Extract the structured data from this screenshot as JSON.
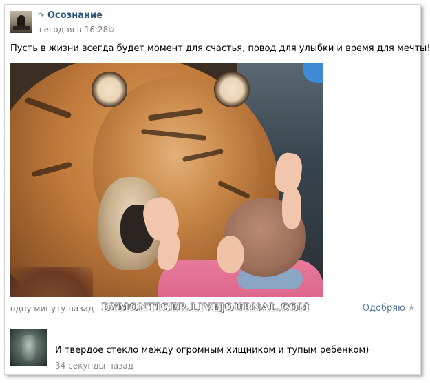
{
  "post": {
    "author": "Осознание",
    "time": "сегодня в 16:28",
    "text": "Пусть в жизни всегда будет момент для счастья, повод для улыбки и время для мечты!",
    "icons": {
      "repost": "repost-icon",
      "settings": "gear-icon"
    }
  },
  "photo": {
    "watermark": "DYMONTIGER.LIVEJOURNAL.COM"
  },
  "meta": {
    "ago": "одну минуту назад",
    "like_label": "Одобряю",
    "like_icon": "star-icon"
  },
  "comment": {
    "text": "И твердое стекло между огромным хищником и тупым ребенком)",
    "time": "34 секунды назад"
  },
  "colors": {
    "link": "#2b587a",
    "muted": "#777777",
    "like": "#5b7a99"
  }
}
